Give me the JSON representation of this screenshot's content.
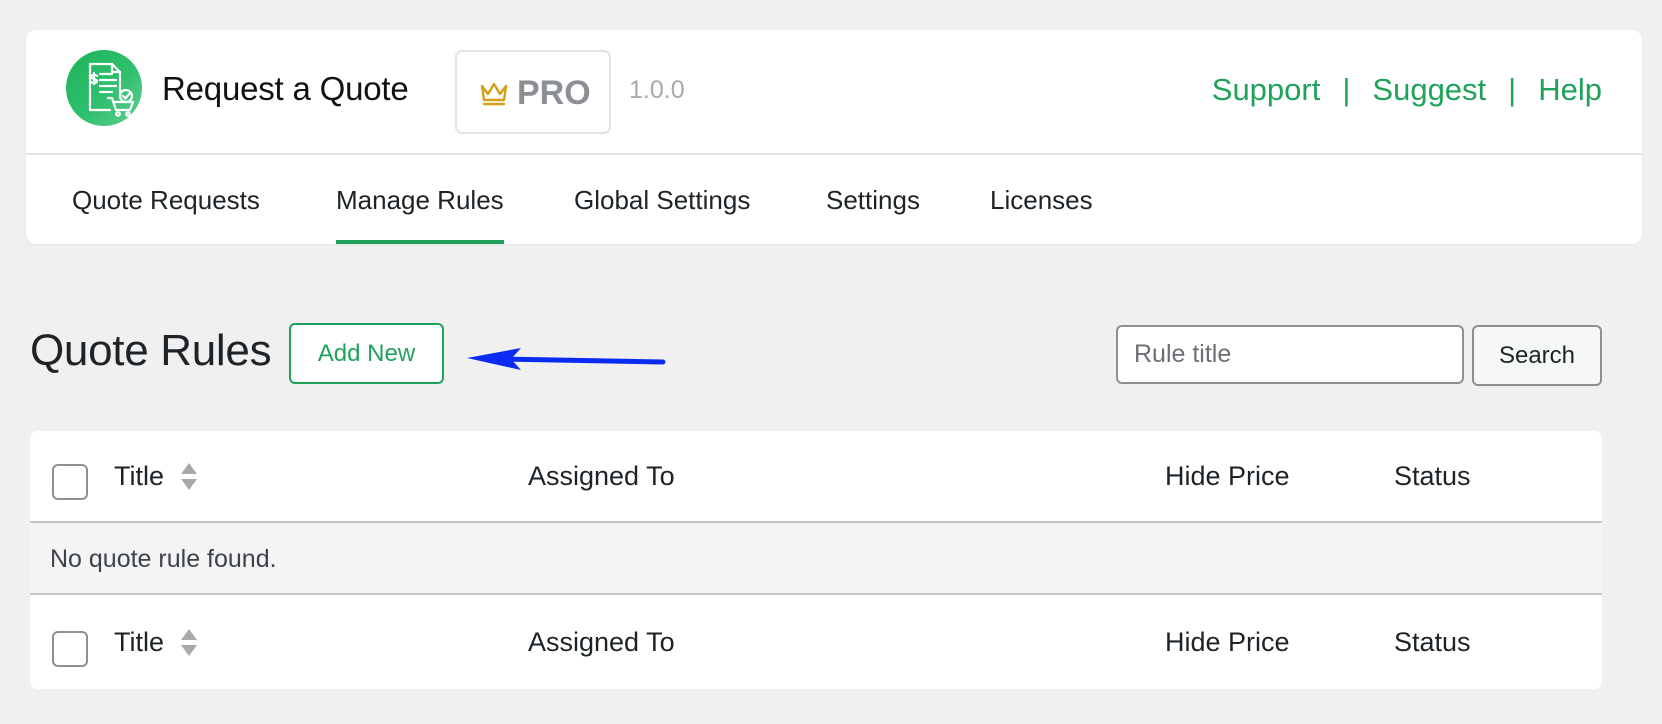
{
  "header": {
    "app_title": "Request a Quote",
    "pro_label": "PRO",
    "version": "1.0.0",
    "links": [
      "Support",
      "Suggest",
      "Help"
    ],
    "separator": "|",
    "logo_icon": "quote-document-cart-icon",
    "badge_icon": "crown-icon"
  },
  "nav": {
    "tabs": [
      {
        "label": "Quote Requests",
        "active": false
      },
      {
        "label": "Manage Rules",
        "active": true
      },
      {
        "label": "Global Settings",
        "active": false
      },
      {
        "label": "Settings",
        "active": false
      },
      {
        "label": "Licenses",
        "active": false
      }
    ]
  },
  "page": {
    "title": "Quote Rules",
    "add_new_label": "Add New",
    "search": {
      "placeholder": "Rule title",
      "value": "",
      "button_label": "Search"
    }
  },
  "table": {
    "columns": [
      "Title",
      "Assigned To",
      "Hide Price",
      "Status"
    ],
    "empty_message": "No quote rule found."
  },
  "colors": {
    "accent": "#1fa35a",
    "annotation_arrow": "#0a2cf2",
    "background": "#f0f0f1"
  }
}
